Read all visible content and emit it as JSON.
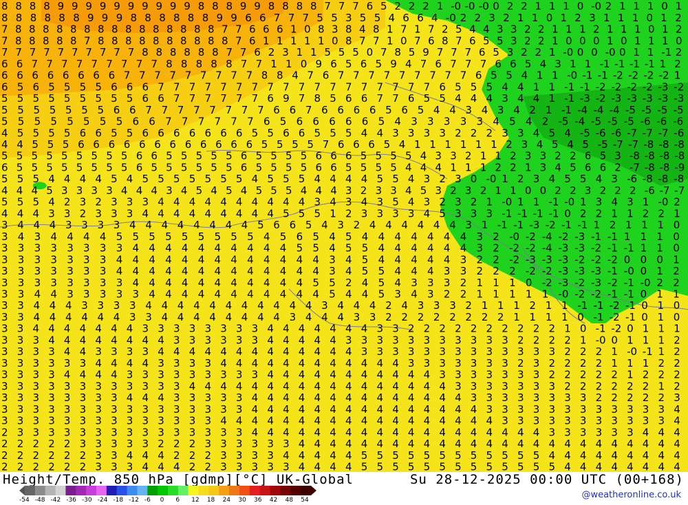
{
  "header": {
    "title": "Height/Temp. 850 hPa [gdmp][°C] UK-Global",
    "valid_time": "Su 28-12-2025 00:00 UTC (00+168)"
  },
  "credit": "@weatheronline.co.uk",
  "legend": {
    "ticks": [
      "-54",
      "-48",
      "-42",
      "-36",
      "-30",
      "-24",
      "-18",
      "-12",
      "-6",
      "0",
      "6",
      "12",
      "18",
      "24",
      "30",
      "36",
      "42",
      "48",
      "54"
    ],
    "colors": [
      "#666666",
      "#8c8c8c",
      "#b4b4b4",
      "#d2d2d2",
      "#7a1e8c",
      "#a028b4",
      "#c83cdc",
      "#e664f0",
      "#1e1eb4",
      "#2850e6",
      "#3c8cf0",
      "#64b4f5",
      "#00a000",
      "#00c800",
      "#28dc28",
      "#64f064",
      "#f5f51e",
      "#f5dc1e",
      "#f5c814",
      "#f5a014",
      "#f07814",
      "#f05014",
      "#e61e1e",
      "#c81414",
      "#a00a0a",
      "#780505",
      "#500000",
      "#3c0000"
    ],
    "colors_note": ""
  },
  "map": {
    "colors": {
      "background_yellow": "#f5e41a",
      "warm_yellow": "#f7cf12",
      "orange": "#f7b30a",
      "green": "#1ed21e",
      "dark_green": "#14b414",
      "coastline": "#7a7a9a"
    },
    "label_rows": [
      "8 8 8 8 9 9 9 9 9 9 9 9 9 9 8 8 8 9 9 8 8 8 8 7 7 7 6 5 2 2 2 1 -0 -0 -0 0 2 2 1 1 1 0 -0 2 1 1 1 0 1",
      "8 8 8 8 8 8 9 9 9 8 8 8 8 8 8 9 9 6 6 7 7 7 5 5 3 5 5 4 6 6 4 -0 2 2 3 2 1 1 0 1 2 3 1 1 1 0 1 2",
      "7 8 8 8 8 8 8 8 8 8 8 8 8 8 8 8 7 7 6 6 6 1 0 8 3 8 4 8 1 7 1 7 2 5 4 4 3 3 2 2 1 1 1 2 1 1 1 0 1 2",
      "7 8 8 8 8 8 7 8 8 8 8 8 8 8 8 8 8 7 6 1 1 1 1 1 0 8 7 7 1 0 7 6 8 7 6 5 5 3 2 2 1 0 0 0 1 0 1 1 1 0",
      "7 7 7 7 7 7 7 7 7 7 8 8 8 8 8 8 7 7 6 2 3 1 1 5 5 5 0 7 8 5 9 7 7 7 6 5 3 2 2 1 -0 0 0 -0 0 1 1 -1 2",
      "6 6 7 7 7 7 7 7 7 7 7 8 8 8 8 8 7 7 1 1 0 9 6 5 6 5 9 4 7 6 7 7 7 6 6 5 4 3 1 1 -1 -1 -1 -1 1 2",
      "6 6 6 6 6 6 6 6 7 7 7 7 7 7 7 7 7 8 8 4 7 6 7 7 7 7 7 7 7 7 7 6 5 5 4 1 1 -0 -1 -1 -2 -2 -2 -2 1",
      "6 5 6 5 5 5 5 6 6 6 7 7 7 7 7 7 7 7 7 7 7 7 7 7 7 7 7 7 6 5 5 5 4 4 1 1 -1 -1 -2 -2 -2 -2 -3 -2",
      "5 5 5 5 5 5 5 5 5 6 6 7 7 7 7 7 7 6 9 7 8 5 6 6 7 7 6 5 5 4 4 4 3 4 4 1 -1 -3 -2 -3 -3 -3 -3 -3",
      "5 5 5 5 5 5 5 6 6 7 7 7 7 7 7 7 7 6 6 7 6 6 6 6 5 6 5 4 4 3 4 3 4 2 1 -1 -4 -4 -4 -5 -5 -5 -5",
      "5 5 5 5 5 5 5 5 6 6 7 7 7 7 7 7 6 5 6 6 6 6 6 5 4 3 3 3 3 3 4 5 4 2 -5 -4 -5 -5 -5 -6 -6 -6",
      "4 5 5 5 5 6 6 5 5 6 6 6 6 6 6 6 5 5 6 6 5 5 5 4 4 3 3 3 3 2 2 2 3 3 4 5 4 -5 -6 -6 -7 -7 -7 -6",
      "4 4 5 5 5 6 6 6 6 6 6 6 6 6 6 6 6 5 5 5 5 7 6 6 6 5 4 1 1 1 1 1 1 2 3 4 5 4 5 -5 -7 -7 -8 -8 -8",
      "5 5 5 5 5 5 5 5 5 6 6 5 5 5 5 5 6 5 5 5 5 6 6 6 5 5 5 5 4 3 3 2 1 1 2 3 3 2 2 6 5 3 -8 -8 -8 -8",
      "6 5 5 5 5 5 5 5 5 6 5 5 5 5 5 5 6 5 5 5 5 6 6 5 5 5 5 4 4 4 1 1 1 2 2 1 3 4 5 6 6 2 -7 -8 -8 -9",
      "5 5 5 4 4 4 4 5 4 5 5 5 5 5 5 5 4 5 5 5 4 4 4 4 5 5 4 3 2 3 0 -0 1 2 3 4 5 5 4 3 -6 -8 -8 -8",
      "4 4 4 5 3 3 3 3 4 4 4 3 4 5 4 5 4 5 5 5 4 4 4 3 2 3 3 4 5 3 2 3 2 1 1 0 0 2 2 3 2 2 2 -6 -7 -7",
      "5 5 5 4 2 3 2 3 3 3 4 4 4 4 4 4 4 4 4 4 3 4 3 4 3 5 4 3 2 3 2 1 -0 1 1 -1 -0 1 3 4 3 1 -0 2",
      "4 4 4 3 3 2 3 3 3 4 4 4 4 4 4 4 4 4 5 5 5 1 2 3 3 3 3 4 5 3 3 3 -1 -1 -1 -1 0 2 2 1 1 2 2 1",
      "3 4 4 4 3 3 3 3 4 4 4 4 4 4 4 4 5 6 6 5 4 3 2 4 4 4 4 4 4 3 1 -1 -1 -3 -2 -1 -1 1 2 1 1 1 0",
      "3 4 3 4 4 4 4 5 5 5 5 5 5 5 5 5 4 5 6 5 4 5 4 4 4 4 4 4 4 3 2 -0 -2 -4 -2 -3 -1 -1 1 1 1 0",
      "3 3 3 3 3 3 3 3 4 4 4 4 4 4 4 4 4 4 5 5 4 5 5 4 4 4 4 4 4 3 2 -2 -2 -4 -3 -3 -2 -1 -1 1 1 0",
      "3 3 3 3 3 3 3 4 4 4 4 4 4 4 4 4 4 4 4 4 3 4 5 4 4 4 4 4 3 2 2 -2 -3 -3 -3 -2 -2 -2 0 0 0 1",
      "3 3 3 3 3 3 3 4 4 4 4 4 4 4 4 4 4 4 4 4 3 4 5 5 4 4 4 3 3 2 2 2 -2 -2 -3 -3 -3 -1 -0 0 1 2",
      "3 3 3 3 3 3 3 3 4 4 4 4 4 4 4 4 4 4 4 5 5 2 4 5 4 3 3 3 2 1 1 1 0 -2 -3 -2 -3 -2 -1 -0 2 2",
      "3 3 4 4 3 3 3 3 3 4 4 4 4 4 4 4 4 4 4 4 5 4 4 5 3 4 3 2 2 1 1 1 1 1 -0 -2 -2 -1 -1 0 1 1",
      "3 3 4 4 4 3 3 3 3 4 4 4 4 4 4 4 4 4 4 4 3 4 4 4 2 4 3 3 3 2 1 1 1 2 1 1 -1 -1 -2 -1 0 1 0",
      "3 3 4 4 4 4 4 4 3 3 4 4 4 4 4 4 4 4 3 4 4 4 3 3 2 2 2 2 2 2 2 2 1 1 1 1 0 -1 -2 -1 0 1 0",
      "3 3 4 4 4 4 4 4 4 3 3 3 3 3 3 3 3 4 4 4 4 4 4 4 3 3 2 2 2 2 2 2 2 2 2 2 1 0 -1 -2 0 1 1 1",
      "3 3 3 4 4 4 4 4 4 4 4 3 3 3 3 3 3 4 4 4 4 4 3 3 3 3 3 3 3 3 3 3 3 2 2 2 2 1 -0 0 1 1 1 2",
      "3 3 3 3 4 4 3 3 3 3 4 4 4 4 4 4 4 4 4 4 4 4 4 3 3 3 3 3 3 3 3 3 3 3 3 3 2 2 2 1 -0 -1 1 2",
      "3 3 3 3 3 3 4 4 4 4 3 3 3 3 4 4 4 4 4 4 4 4 4 4 4 4 3 3 3 3 3 3 3 2 3 2 2 2 2 1 1 1 2 2",
      "3 3 3 3 4 4 4 4 3 3 3 3 3 3 3 3 3 4 4 4 4 4 4 4 4 4 4 4 3 3 3 3 3 3 3 2 2 2 2 2 1 2 2 2",
      "3 3 3 3 3 3 3 3 3 3 3 3 4 4 4 4 4 4 4 4 4 4 4 4 4 4 4 4 4 3 3 3 3 3 3 3 2 2 2 2 2 2 1 2",
      "3 3 3 3 3 3 3 3 4 4 4 3 3 3 3 3 4 4 4 4 4 4 4 4 4 4 4 4 4 4 3 3 3 3 3 3 3 3 2 2 2 2 2 3",
      "3 3 3 3 3 3 3 3 3 3 3 3 3 3 3 3 4 4 4 4 4 4 4 4 4 4 4 4 4 4 4 3 3 3 3 3 3 3 3 3 3 3 3 4",
      "3 3 3 3 3 3 3 3 3 3 3 3 3 3 4 4 4 4 4 4 4 4 4 4 4 4 4 4 4 4 4 4 3 3 3 3 3 3 3 3 3 3 3 4",
      "2 3 3 3 3 3 3 3 3 3 3 3 3 3 3 3 4 4 4 4 4 4 4 4 4 4 4 4 4 4 4 4 4 4 4 3 3 3 3 3 3 4 4 4",
      "2 2 2 2 2 3 3 3 3 3 2 2 2 3 3 3 3 3 3 4 4 4 4 4 4 4 4 4 4 4 4 4 4 4 4 4 4 4 4 4 4 4 4 4",
      "2 2 2 2 2 2 3 3 4 4 4 2 2 2 3 3 3 3 4 4 4 4 4 5 5 5 5 5 5 5 5 5 5 5 5 4 4 4 4 4 4 4 4 4",
      "2 2 2 2 2 2 3 3 3 4 4 4 2 2 3 3 3 3 3 4 4 4 4 5 5 5 5 5 5 5 5 5 5 5 5 5 4 4 4 4 4 4 4 4"
    ]
  }
}
